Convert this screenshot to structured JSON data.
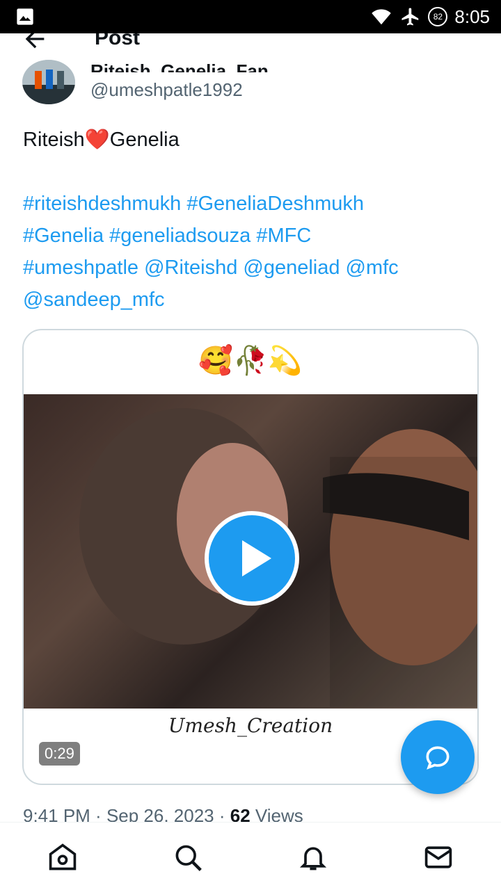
{
  "status_bar": {
    "time": "8:05",
    "battery": "82",
    "icons": [
      "image-icon",
      "wifi-icon",
      "airplane-icon",
      "battery-icon"
    ]
  },
  "header": {
    "title": "Post",
    "back_icon": "back-arrow-icon"
  },
  "author": {
    "display_name": "Riteish_Genelia_Fan",
    "handle": "@umeshpatle1992"
  },
  "tweet": {
    "text_before": "Riteish",
    "heart": "❤️",
    "text_after": "Genelia",
    "line1": "#riteishdeshmukh #GeneliaDeshmukh",
    "line2": "#Genelia #geneliadsouza #MFC",
    "line3": "#umeshpatle @Riteishd @geneliad @mfc",
    "line4": "@sandeep_mfc"
  },
  "media": {
    "top_emoji": "🥰🥀💫",
    "caption": "Umesh_Creation",
    "duration": "0:29",
    "play_icon": "play-icon"
  },
  "meta": {
    "time": "9:41 PM",
    "date": "Sep 26, 2023",
    "views_count": "62",
    "views_label": "Views"
  },
  "fab": {
    "icon": "reply-bubble-icon"
  },
  "nav": [
    "home-icon",
    "search-icon",
    "notifications-bell-icon",
    "messages-mail-icon"
  ],
  "colors": {
    "accent": "#1d9bf0",
    "text": "#0f1419",
    "secondary": "#536471",
    "heart": "#e0245e"
  }
}
